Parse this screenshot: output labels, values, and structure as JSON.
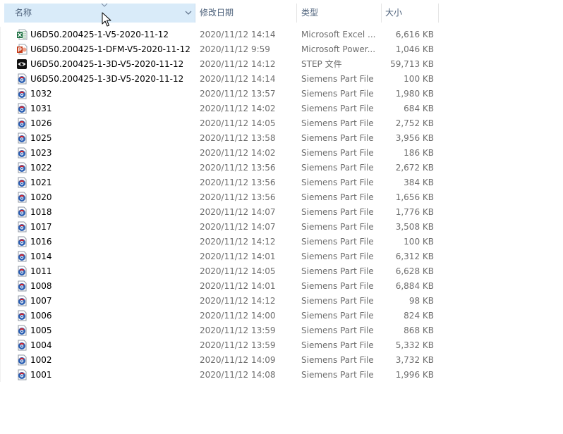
{
  "header": {
    "name": "名称",
    "date": "修改日期",
    "type": "类型",
    "size": "大小"
  },
  "files": [
    {
      "name": "U6D50.200425-1-V5-2020-11-12",
      "date": "2020/11/12 14:14",
      "type": "Microsoft Excel ...",
      "size": "6,616 KB",
      "icon": "excel-file-icon"
    },
    {
      "name": "U6D50.200425-1-DFM-V5-2020-11-12",
      "date": "2020/11/12 9:59",
      "type": "Microsoft Power...",
      "size": "1,046 KB",
      "icon": "powerpoint-file-icon"
    },
    {
      "name": "U6D50.200425-1-3D-V5-2020-11-12",
      "date": "2020/11/12 14:12",
      "type": "STEP 文件",
      "size": "59,713 KB",
      "icon": "step-viewer-file-icon"
    },
    {
      "name": "U6D50.200425-1-3D-V5-2020-11-12",
      "date": "2020/11/12 14:14",
      "type": "Siemens Part File",
      "size": "100 KB",
      "icon": "siemens-part-file-icon"
    },
    {
      "name": "1032",
      "date": "2020/11/12 13:57",
      "type": "Siemens Part File",
      "size": "1,980 KB",
      "icon": "siemens-part-file-icon"
    },
    {
      "name": "1031",
      "date": "2020/11/12 14:02",
      "type": "Siemens Part File",
      "size": "684 KB",
      "icon": "siemens-part-file-icon"
    },
    {
      "name": "1026",
      "date": "2020/11/12 14:05",
      "type": "Siemens Part File",
      "size": "2,752 KB",
      "icon": "siemens-part-file-icon"
    },
    {
      "name": "1025",
      "date": "2020/11/12 13:58",
      "type": "Siemens Part File",
      "size": "3,956 KB",
      "icon": "siemens-part-file-icon"
    },
    {
      "name": "1023",
      "date": "2020/11/12 14:02",
      "type": "Siemens Part File",
      "size": "186 KB",
      "icon": "siemens-part-file-icon"
    },
    {
      "name": "1022",
      "date": "2020/11/12 13:56",
      "type": "Siemens Part File",
      "size": "2,672 KB",
      "icon": "siemens-part-file-icon"
    },
    {
      "name": "1021",
      "date": "2020/11/12 13:56",
      "type": "Siemens Part File",
      "size": "384 KB",
      "icon": "siemens-part-file-icon"
    },
    {
      "name": "1020",
      "date": "2020/11/12 13:56",
      "type": "Siemens Part File",
      "size": "1,656 KB",
      "icon": "siemens-part-file-icon"
    },
    {
      "name": "1018",
      "date": "2020/11/12 14:07",
      "type": "Siemens Part File",
      "size": "1,776 KB",
      "icon": "siemens-part-file-icon"
    },
    {
      "name": "1017",
      "date": "2020/11/12 14:07",
      "type": "Siemens Part File",
      "size": "3,508 KB",
      "icon": "siemens-part-file-icon"
    },
    {
      "name": "1016",
      "date": "2020/11/12 14:12",
      "type": "Siemens Part File",
      "size": "100 KB",
      "icon": "siemens-part-file-icon"
    },
    {
      "name": "1014",
      "date": "2020/11/12 14:01",
      "type": "Siemens Part File",
      "size": "6,312 KB",
      "icon": "siemens-part-file-icon"
    },
    {
      "name": "1011",
      "date": "2020/11/12 14:05",
      "type": "Siemens Part File",
      "size": "6,628 KB",
      "icon": "siemens-part-file-icon"
    },
    {
      "name": "1008",
      "date": "2020/11/12 14:01",
      "type": "Siemens Part File",
      "size": "6,884 KB",
      "icon": "siemens-part-file-icon"
    },
    {
      "name": "1007",
      "date": "2020/11/12 14:12",
      "type": "Siemens Part File",
      "size": "98 KB",
      "icon": "siemens-part-file-icon"
    },
    {
      "name": "1006",
      "date": "2020/11/12 14:00",
      "type": "Siemens Part File",
      "size": "824 KB",
      "icon": "siemens-part-file-icon"
    },
    {
      "name": "1005",
      "date": "2020/11/12 13:59",
      "type": "Siemens Part File",
      "size": "868 KB",
      "icon": "siemens-part-file-icon"
    },
    {
      "name": "1004",
      "date": "2020/11/12 13:59",
      "type": "Siemens Part File",
      "size": "5,332 KB",
      "icon": "siemens-part-file-icon"
    },
    {
      "name": "1002",
      "date": "2020/11/12 14:09",
      "type": "Siemens Part File",
      "size": "3,732 KB",
      "icon": "siemens-part-file-icon"
    },
    {
      "name": "1001",
      "date": "2020/11/12 14:08",
      "type": "Siemens Part File",
      "size": "1,996 KB",
      "icon": "siemens-part-file-icon"
    }
  ],
  "colors": {
    "header_selected_bg": "#d9ebf9",
    "header_text": "#4c607a",
    "detail_text": "#6d6d6d",
    "excel_green": "#1f7244",
    "powerpoint_red": "#c43e1c",
    "siemens_blue": "#2b5fb3",
    "siemens_red": "#d8232a"
  }
}
